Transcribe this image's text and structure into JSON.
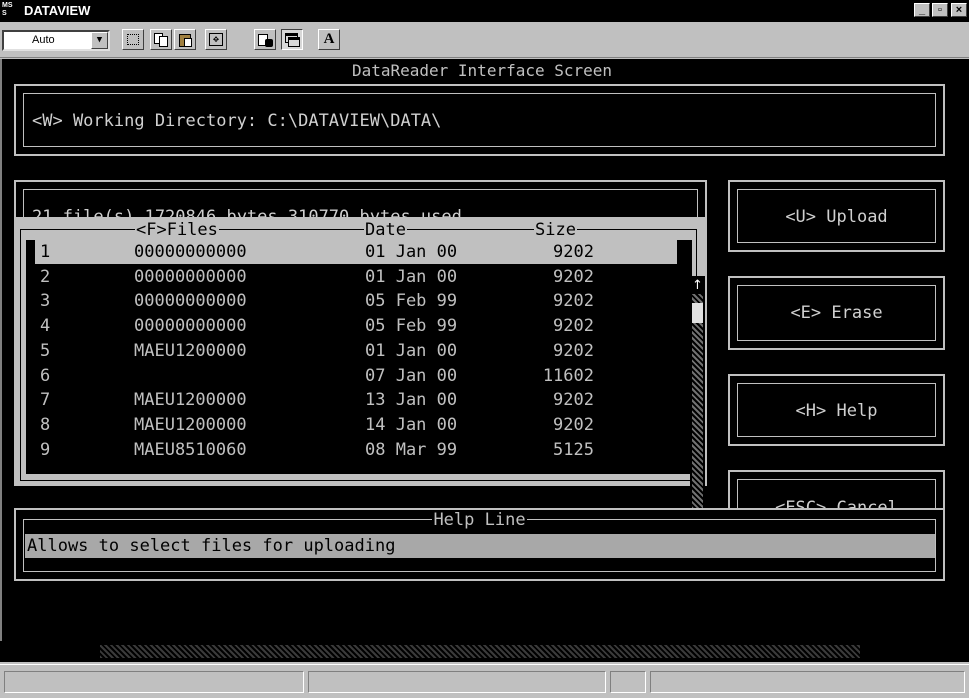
{
  "window": {
    "icon_text": "MS\nS",
    "title": "DATAVIEW",
    "min_glyph": "_",
    "max_glyph": "▫",
    "close_glyph": "×"
  },
  "toolbar": {
    "font_size_value": "Auto",
    "dropdown_glyph": "▼",
    "fullscreen_glyph": "✥",
    "font_glyph": "A"
  },
  "screen": {
    "title": "DataReader Interface Screen",
    "working_directory": "<W> Working Directory: C:\\DATAVIEW\\DATA\\",
    "file_summary": "21 file(s),1720846 bytes,310770 bytes used"
  },
  "buttons": {
    "upload": "<U> Upload",
    "erase": "<E> Erase",
    "help": "<H> Help",
    "cancel": "<ESC> Cancel"
  },
  "file_list": {
    "headers": {
      "files": "<F>Files",
      "date": "Date",
      "size": "Size"
    },
    "scroll_up": "↑",
    "scroll_down": "↓",
    "rows": [
      {
        "num": "1",
        "name": "00000000000",
        "date": "01 Jan 00",
        "size": "9202"
      },
      {
        "num": "2",
        "name": "00000000000",
        "date": "01 Jan 00",
        "size": "9202"
      },
      {
        "num": "3",
        "name": "00000000000",
        "date": "05 Feb 99",
        "size": "9202"
      },
      {
        "num": "4",
        "name": "00000000000",
        "date": "05 Feb 99",
        "size": "9202"
      },
      {
        "num": "5",
        "name": "MAEU1200000",
        "date": "01 Jan 00",
        "size": "9202"
      },
      {
        "num": "6",
        "name": "",
        "date": "07 Jan 00",
        "size": "11602"
      },
      {
        "num": "7",
        "name": "MAEU1200000",
        "date": "13 Jan 00",
        "size": "9202"
      },
      {
        "num": "8",
        "name": "MAEU1200000",
        "date": "14 Jan 00",
        "size": "9202"
      },
      {
        "num": "9",
        "name": "MAEU8510060",
        "date": "08 Mar 99",
        "size": "5125"
      }
    ]
  },
  "help_line": {
    "label": "Help Line",
    "text": "Allows to select files for uploading"
  }
}
